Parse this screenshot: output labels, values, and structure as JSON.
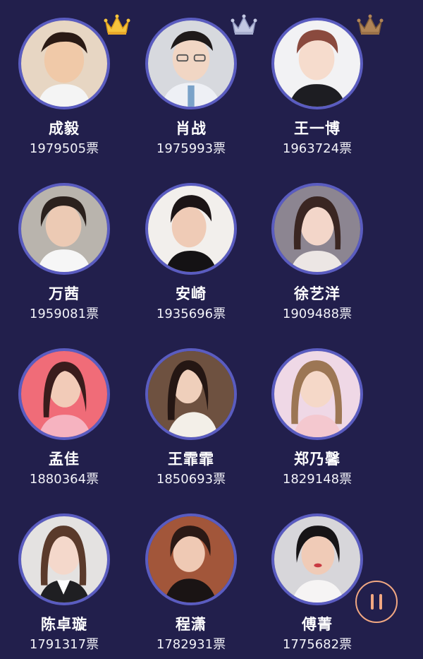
{
  "colors": {
    "background": "#221f4c",
    "avatar_ring": "#5a5cc0",
    "crown_gold": "#f6c43d",
    "crown_silver": "#c2c7e2",
    "crown_bronze": "#b08457",
    "pause_accent": "#f2a882"
  },
  "ranking": [
    {
      "name": "成毅",
      "votes": "1979505票",
      "crown": "gold-crown-icon"
    },
    {
      "name": "肖战",
      "votes": "1975993票",
      "crown": "silver-crown-icon"
    },
    {
      "name": "王一博",
      "votes": "1963724票",
      "crown": "bronze-crown-icon"
    },
    {
      "name": "万茜",
      "votes": "1959081票"
    },
    {
      "name": "安崎",
      "votes": "1935696票"
    },
    {
      "name": "徐艺洋",
      "votes": "1909488票"
    },
    {
      "name": "孟佳",
      "votes": "1880364票"
    },
    {
      "name": "王霏霏",
      "votes": "1850693票"
    },
    {
      "name": "郑乃馨",
      "votes": "1829148票"
    },
    {
      "name": "陈卓璇",
      "votes": "1791317票"
    },
    {
      "name": "程潇",
      "votes": "1782931票"
    },
    {
      "name": "傅菁",
      "votes": "1775682票"
    }
  ],
  "controls": {
    "pause_icon": "pause-icon"
  }
}
